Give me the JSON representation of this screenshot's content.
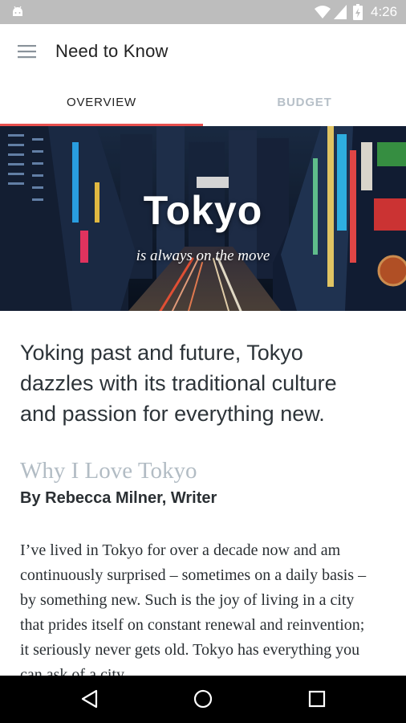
{
  "status_bar": {
    "time": "4:26",
    "icons": [
      "android-icon",
      "wifi-icon",
      "cellular-signal-icon",
      "battery-charging-icon"
    ]
  },
  "app_bar": {
    "title": "Need to Know",
    "menu_icon": "hamburger-menu-icon"
  },
  "tabs": [
    {
      "label": "OVERVIEW",
      "selected": true
    },
    {
      "label": "BUDGET",
      "selected": false
    }
  ],
  "hero": {
    "city": "Tokyo",
    "tagline": "is always on the move"
  },
  "content": {
    "lede": "Yoking past and future, Tokyo dazzles with its traditional culture and passion for everything new.",
    "section_title": "Why I Love Tokyo",
    "byline": "By Rebecca Milner, Writer",
    "body": "I’ve lived in Tokyo for over a decade now and am continuously surprised – sometimes on a daily basis – by something new. Such is the joy of living in a city that prides itself on constant renewal and reinvention; it seriously never gets old. Tokyo has everything you can ask of a city."
  },
  "nav_bar": {
    "buttons": [
      "back-icon",
      "home-icon",
      "recents-icon"
    ]
  },
  "colors": {
    "accent": "#e8504e",
    "status_bar": "#bdbdbd",
    "tab_inactive": "#b7c0c8",
    "section_title": "#b2bcc4"
  }
}
